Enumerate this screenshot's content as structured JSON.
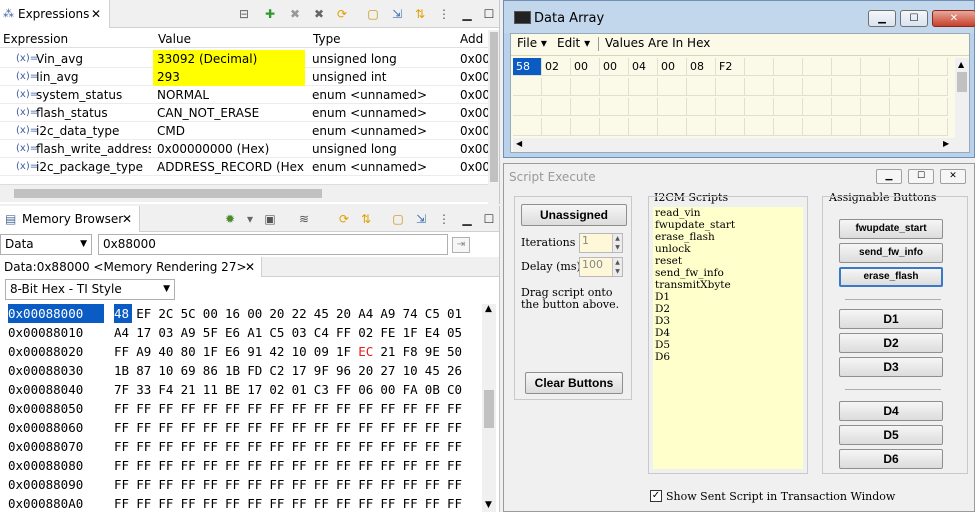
{
  "expressions": {
    "tab_label": "Expressions",
    "columns": [
      "Expression",
      "Value",
      "Type",
      "Add"
    ],
    "rows": [
      {
        "name": "Vin_avg",
        "value": "33092 (Decimal)",
        "type": "unsigned long",
        "addr": "0x00",
        "highlight": true
      },
      {
        "name": "Iin_avg",
        "value": "293",
        "type": "unsigned int",
        "addr": "0x00",
        "highlight": true
      },
      {
        "name": "system_status",
        "value": "NORMAL",
        "type": "enum <unnamed>",
        "addr": "0x00",
        "highlight": false
      },
      {
        "name": "flash_status",
        "value": "CAN_NOT_ERASE",
        "type": "enum <unnamed>",
        "addr": "0x00",
        "highlight": false
      },
      {
        "name": "i2c_data_type",
        "value": "CMD",
        "type": "enum <unnamed>",
        "addr": "0x00",
        "highlight": false
      },
      {
        "name": "flash_write_address",
        "value": "0x00000000 (Hex)",
        "type": "unsigned long",
        "addr": "0x00",
        "highlight": false
      },
      {
        "name": "i2c_package_type",
        "value": "ADDRESS_RECORD (Hex)",
        "type": "enum <unnamed>",
        "addr": "0x00",
        "highlight": false
      }
    ]
  },
  "memory": {
    "tab_label": "Memory Browser",
    "space": "Data",
    "address_input": "0x88000",
    "rendering_tab": "Data:0x88000 <Memory Rendering 27>",
    "format": "8-Bit Hex - TI Style",
    "lines": [
      {
        "addr": "0x00088000",
        "bytes": [
          "48",
          "EF",
          "2C",
          "5C",
          "00",
          "16",
          "00",
          "20",
          "22",
          "45",
          "20",
          "A4",
          "A9",
          "74",
          "C5",
          "01"
        ]
      },
      {
        "addr": "0x00088010",
        "bytes": [
          "A4",
          "17",
          "03",
          "A9",
          "5F",
          "E6",
          "A1",
          "C5",
          "03",
          "C4",
          "FF",
          "02",
          "FE",
          "1F",
          "E4",
          "05"
        ]
      },
      {
        "addr": "0x00088020",
        "bytes": [
          "FF",
          "A9",
          "40",
          "80",
          "1F",
          "E6",
          "91",
          "42",
          "10",
          "09",
          "1F",
          "EC",
          "21",
          "F8",
          "9E",
          "50"
        ]
      },
      {
        "addr": "0x00088030",
        "bytes": [
          "1B",
          "87",
          "10",
          "69",
          "86",
          "1B",
          "FD",
          "C2",
          "17",
          "9F",
          "96",
          "20",
          "27",
          "10",
          "45",
          "26"
        ]
      },
      {
        "addr": "0x00088040",
        "bytes": [
          "7F",
          "33",
          "F4",
          "21",
          "11",
          "BE",
          "17",
          "02",
          "01",
          "C3",
          "FF",
          "06",
          "00",
          "FA",
          "0B",
          "C0"
        ]
      },
      {
        "addr": "0x00088050",
        "bytes": [
          "FF",
          "FF",
          "FF",
          "FF",
          "FF",
          "FF",
          "FF",
          "FF",
          "FF",
          "FF",
          "FF",
          "FF",
          "FF",
          "FF",
          "FF",
          "FF"
        ]
      },
      {
        "addr": "0x00088060",
        "bytes": [
          "FF",
          "FF",
          "FF",
          "FF",
          "FF",
          "FF",
          "FF",
          "FF",
          "FF",
          "FF",
          "FF",
          "FF",
          "FF",
          "FF",
          "FF",
          "FF"
        ]
      },
      {
        "addr": "0x00088070",
        "bytes": [
          "FF",
          "FF",
          "FF",
          "FF",
          "FF",
          "FF",
          "FF",
          "FF",
          "FF",
          "FF",
          "FF",
          "FF",
          "FF",
          "FF",
          "FF",
          "FF"
        ]
      },
      {
        "addr": "0x00088080",
        "bytes": [
          "FF",
          "FF",
          "FF",
          "FF",
          "FF",
          "FF",
          "FF",
          "FF",
          "FF",
          "FF",
          "FF",
          "FF",
          "FF",
          "FF",
          "FF",
          "FF"
        ]
      },
      {
        "addr": "0x00088090",
        "bytes": [
          "FF",
          "FF",
          "FF",
          "FF",
          "FF",
          "FF",
          "FF",
          "FF",
          "FF",
          "FF",
          "FF",
          "FF",
          "FF",
          "FF",
          "FF",
          "FF"
        ]
      },
      {
        "addr": "0x000880A0",
        "bytes": [
          "FF",
          "FF",
          "FF",
          "FF",
          "FF",
          "FF",
          "FF",
          "FF",
          "FF",
          "FF",
          "FF",
          "FF",
          "FF",
          "FF",
          "FF",
          "FF"
        ]
      }
    ],
    "changed_byte_color": "#e02020",
    "selection_color": "#0a5bc4"
  },
  "data_array": {
    "title": "Data Array",
    "menu": [
      "File",
      "Edit",
      "Values Are In Hex"
    ],
    "values": [
      "58",
      "02",
      "00",
      "00",
      "04",
      "00",
      "08",
      "F2"
    ]
  },
  "script_execute": {
    "title": "Script Execute",
    "unassigned_label": "Unassigned",
    "iterations_label": "Iterations",
    "iterations_value": "1",
    "delay_label": "Delay (ms)",
    "delay_value": "100",
    "hint": "Drag script onto the button above.",
    "clear_label": "Clear Buttons",
    "scripts_header": "I2CM Scripts",
    "scripts": [
      "read_vin",
      "fwupdate_start",
      "erase_flash",
      "unlock",
      "reset",
      "send_fw_info",
      "transmitXbyte",
      "D1",
      "D2",
      "D3",
      "D4",
      "D5",
      "D6"
    ],
    "assignable_header": "Assignable Buttons",
    "assigned_buttons_top": [
      "fwupdate_start",
      "send_fw_info",
      "erase_flash"
    ],
    "assigned_buttons_mid": [
      "D1",
      "D2",
      "D3"
    ],
    "assigned_buttons_bottom": [
      "D4",
      "D5",
      "D6"
    ],
    "checkbox_label": "Show Sent Script in Transaction Window"
  }
}
